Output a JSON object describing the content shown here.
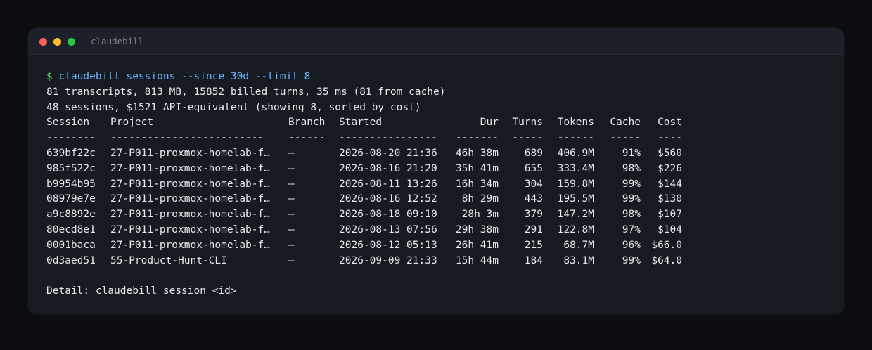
{
  "window": {
    "title": "claudebill",
    "controls": {
      "close_color": "#fe5f57",
      "minimize_color": "#febc2e",
      "zoom_color": "#28c840"
    }
  },
  "colors": {
    "background": "#161a21",
    "text": "#e6e8eb",
    "prompt": "#59c46b",
    "command": "#6cb6ff"
  },
  "terminal": {
    "prompt_symbol": "$",
    "command": "claudebill sessions --since 30d --limit 8",
    "summary_line_1": "81 transcripts, 813 MB, 15852 billed turns, 35 ms (81 from cache)",
    "summary_line_2": "48 sessions, $1521 API-equivalent (showing 8, sorted by cost)",
    "headers": {
      "session": "Session",
      "project": "Project",
      "branch": "Branch",
      "started": "Started",
      "dur": "Dur",
      "turns": "Turns",
      "tokens": "Tokens",
      "cache": "Cache",
      "cost": "Cost"
    },
    "separators": {
      "session": "--------",
      "project": "-------------------------",
      "branch": "------",
      "started": "----------------",
      "dur": "-------",
      "turns": "-----",
      "tokens": "------",
      "cache": "-----",
      "cost": "----"
    },
    "rows": [
      {
        "session": "639bf22c",
        "project": "27-P011-proxmox-homelab-f…",
        "branch": "—",
        "started": "2026-08-20 21:36",
        "dur": "46h 38m",
        "turns": "689",
        "tokens": "406.9M",
        "cache": "91%",
        "cost": "$560"
      },
      {
        "session": "985f522c",
        "project": "27-P011-proxmox-homelab-f…",
        "branch": "—",
        "started": "2026-08-16 21:20",
        "dur": "35h 41m",
        "turns": "655",
        "tokens": "333.4M",
        "cache": "98%",
        "cost": "$226"
      },
      {
        "session": "b9954b95",
        "project": "27-P011-proxmox-homelab-f…",
        "branch": "—",
        "started": "2026-08-11 13:26",
        "dur": "16h 34m",
        "turns": "304",
        "tokens": "159.8M",
        "cache": "99%",
        "cost": "$144"
      },
      {
        "session": "08979e7e",
        "project": "27-P011-proxmox-homelab-f…",
        "branch": "—",
        "started": "2026-08-16 12:52",
        "dur": "8h 29m",
        "turns": "443",
        "tokens": "195.5M",
        "cache": "99%",
        "cost": "$130"
      },
      {
        "session": "a9c8892e",
        "project": "27-P011-proxmox-homelab-f…",
        "branch": "—",
        "started": "2026-08-18 09:10",
        "dur": "28h 3m",
        "turns": "379",
        "tokens": "147.2M",
        "cache": "98%",
        "cost": "$107"
      },
      {
        "session": "80ecd8e1",
        "project": "27-P011-proxmox-homelab-f…",
        "branch": "—",
        "started": "2026-08-13 07:56",
        "dur": "29h 38m",
        "turns": "291",
        "tokens": "122.8M",
        "cache": "97%",
        "cost": "$104"
      },
      {
        "session": "0001baca",
        "project": "27-P011-proxmox-homelab-f…",
        "branch": "—",
        "started": "2026-08-12 05:13",
        "dur": "26h 41m",
        "turns": "215",
        "tokens": "68.7M",
        "cache": "96%",
        "cost": "$66.0"
      },
      {
        "session": "0d3aed51",
        "project": "55-Product-Hunt-CLI",
        "branch": "—",
        "started": "2026-09-09 21:33",
        "dur": "15h 44m",
        "turns": "184",
        "tokens": "83.1M",
        "cache": "99%",
        "cost": "$64.0"
      }
    ],
    "detail_line": "Detail: claudebill session <id>"
  }
}
